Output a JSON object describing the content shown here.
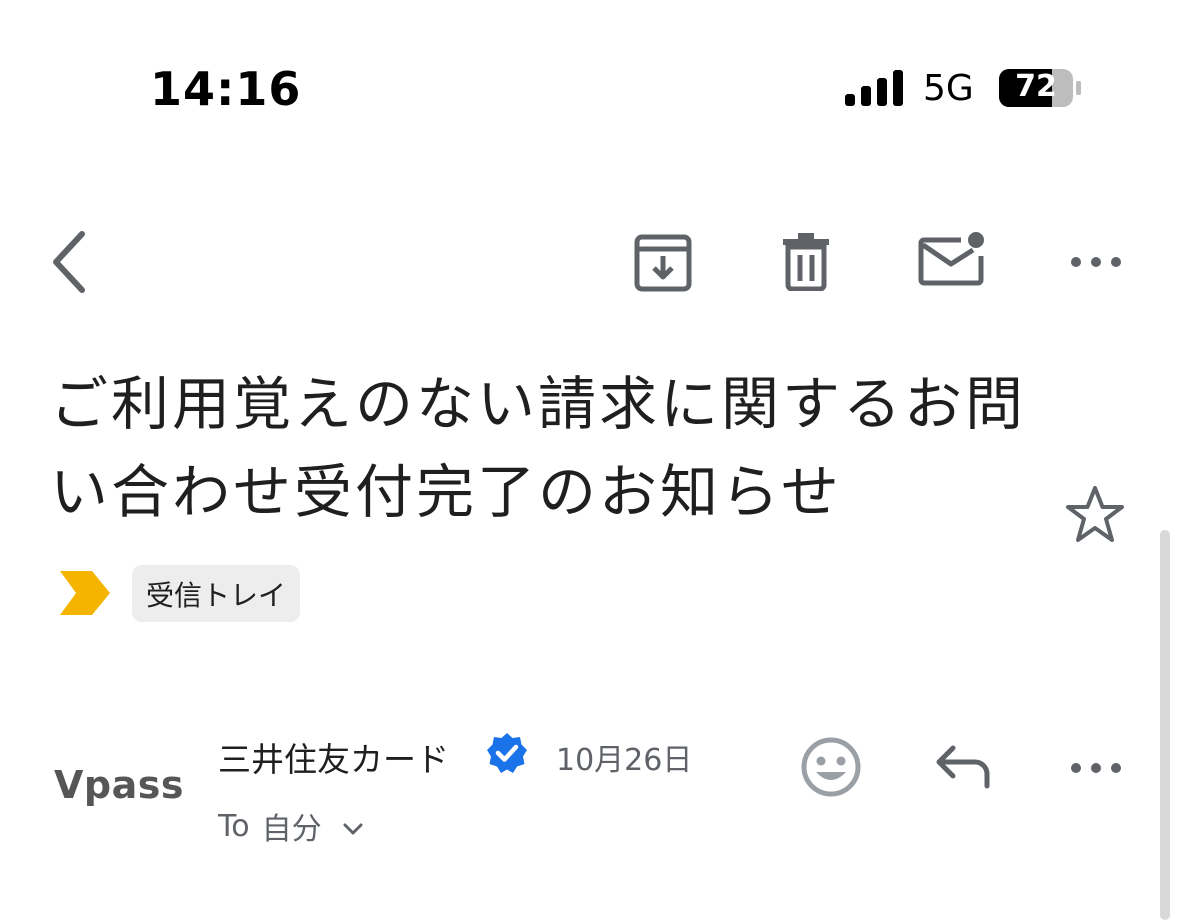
{
  "status_bar": {
    "time": "14:16",
    "network": "5G",
    "battery_level": "72"
  },
  "toolbar": {
    "back_icon": "chevron-left-icon",
    "archive_icon": "archive-icon",
    "delete_icon": "trash-icon",
    "mark_unread_icon": "mail-unread-icon",
    "more_icon": "more-horizontal-icon"
  },
  "email": {
    "subject": "ご利用覚えのない請求に関するお問い合わせ受付完了のお知らせ",
    "starred": false,
    "label": "受信トレイ",
    "label_color": "#f4b400",
    "sender": {
      "avatar_text": "Vpass",
      "name": "三井住友カード",
      "verified": true,
      "verified_color": "#1a73e8",
      "date": "10月26日",
      "to_prefix": "To",
      "to_recipient": "自分"
    }
  },
  "colors": {
    "icon_gray": "#5f6368",
    "background": "#ffffff"
  }
}
